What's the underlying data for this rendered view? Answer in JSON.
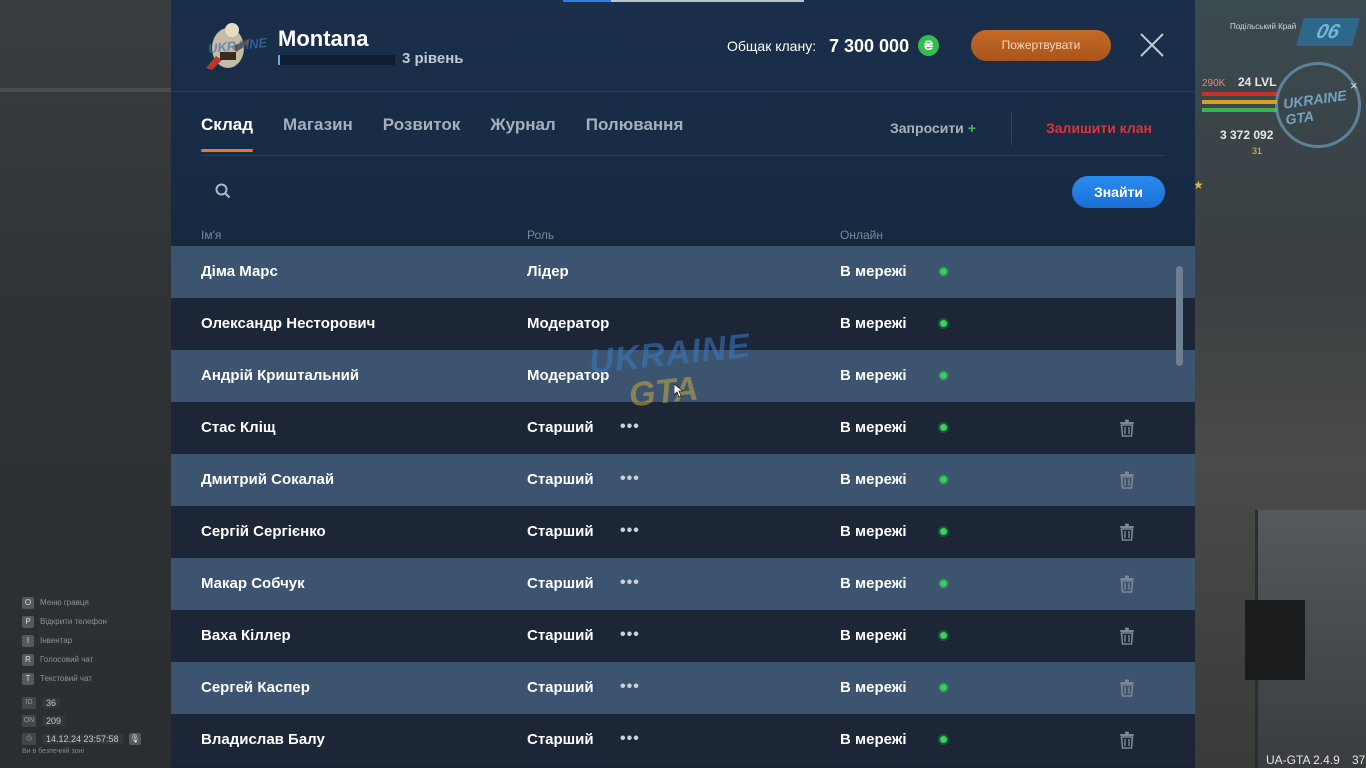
{
  "clan": {
    "name": "Montana",
    "level": "3 рівень",
    "treasury_label": "Общак клану:",
    "treasury_value": "7 300 000",
    "currency_symbol": "₴",
    "donate_label": "Пожертвувати"
  },
  "tabs": [
    {
      "label": "Склад",
      "active": true
    },
    {
      "label": "Магазин",
      "active": false
    },
    {
      "label": "Розвиток",
      "active": false
    },
    {
      "label": "Журнал",
      "active": false
    },
    {
      "label": "Полювання",
      "active": false
    }
  ],
  "actions": {
    "invite_label": "Запросити",
    "invite_plus": "+",
    "leave_label": "Залишити клан"
  },
  "search": {
    "value": "",
    "button_label": "Знайти"
  },
  "columns": {
    "name": "Ім'я",
    "role": "Роль",
    "online": "Онлайн"
  },
  "members": [
    {
      "name": "Діма Марс",
      "role": "Лідер",
      "status": "В мережі",
      "has_menu": false,
      "removable": false
    },
    {
      "name": "Олександр Несторович",
      "role": "Модератор",
      "status": "В мережі",
      "has_menu": false,
      "removable": false
    },
    {
      "name": "Андрій Криштальний",
      "role": "Модератор",
      "status": "В мережі",
      "has_menu": false,
      "removable": false
    },
    {
      "name": "Стас Кліщ",
      "role": "Старший",
      "status": "В мережі",
      "has_menu": true,
      "removable": true
    },
    {
      "name": "Дмитрий Сокалай",
      "role": "Старший",
      "status": "В мережі",
      "has_menu": true,
      "removable": true
    },
    {
      "name": "Сергій Сергієнко",
      "role": "Старший",
      "status": "В мережі",
      "has_menu": true,
      "removable": true
    },
    {
      "name": "Макар Собчук",
      "role": "Старший",
      "status": "В мережі",
      "has_menu": true,
      "removable": true
    },
    {
      "name": "Ваха Кіллер",
      "role": "Старший",
      "status": "В мережі",
      "has_menu": true,
      "removable": true
    },
    {
      "name": "Сергей Каспер",
      "role": "Старший",
      "status": "В мережі",
      "has_menu": true,
      "removable": true
    },
    {
      "name": "Владислав Балу",
      "role": "Старший",
      "status": "В мережі",
      "has_menu": true,
      "removable": true
    }
  ],
  "row_menu_glyph": "•••",
  "watermark": {
    "top": "UKRAINE",
    "bottom": "GTA"
  },
  "emblem_text": "UKRAINE",
  "hud": {
    "district": "Подільський Край",
    "district_num": "06",
    "money_small": "290K",
    "level": "24 LVL",
    "cash": "3 372 092",
    "coins": "31",
    "logo": "UKRAINE GTA",
    "zoom": "×",
    "keys": [
      {
        "key": "O",
        "label": "Меню гравця"
      },
      {
        "key": "P",
        "label": "Відкрити телефон"
      },
      {
        "key": "I",
        "label": "Інвентар"
      },
      {
        "key": "R",
        "label": "Голосовий чат"
      },
      {
        "key": "T",
        "label": "Текстовий чат"
      }
    ],
    "stats": [
      {
        "key": "ID",
        "value": "36"
      },
      {
        "key": "ON",
        "value": "209"
      },
      {
        "key": "◷",
        "value": "14.12.24 23:57:58"
      }
    ],
    "mic_glyph": "🎙",
    "status_text": "Ви в безпечній зоні",
    "version": "UA-GTA 2.4.9",
    "fps": "37"
  },
  "colors": {
    "accent_orange": "#e07a3a",
    "primary_blue": "#1b6fd4",
    "online_green": "#39d05a",
    "leave_red": "#e0343a"
  }
}
